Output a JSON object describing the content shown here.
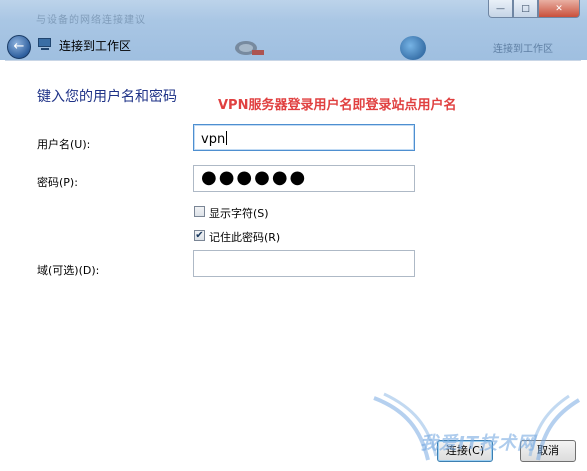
{
  "window": {
    "ghost_title": "与设备的网络连接建议",
    "minimize_label": "—",
    "maximize_label": "□",
    "close_label": "✕",
    "back_arrow": "←",
    "heading": "连接到工作区",
    "ghost_right": "连接到工作区"
  },
  "form": {
    "section_title": "键入您的用户名和密码",
    "annotation": "VPN服务器登录用户名即登录站点用户名",
    "username_label": "用户名(U):",
    "username_value": "vpn",
    "password_label": "密码(P):",
    "password_mask": "●●●●●●",
    "show_chars_label": "显示字符(S)",
    "show_chars_checked": false,
    "remember_label": "记住此密码(R)",
    "remember_checked": true,
    "remember_mark": "✔",
    "domain_label": "域(可选)(D):",
    "domain_value": ""
  },
  "buttons": {
    "connect_label": "连接(C)",
    "cancel_label": "取消"
  },
  "watermark": {
    "text": "我爱IT技术网"
  },
  "colors": {
    "titlebar": "#a9c6e4",
    "section_title": "#1e3287",
    "annotation": "#e04040"
  },
  "icons": {
    "back": "back-arrow-icon",
    "wizard": "network-wizard-icon",
    "globe": "globe-icon"
  }
}
